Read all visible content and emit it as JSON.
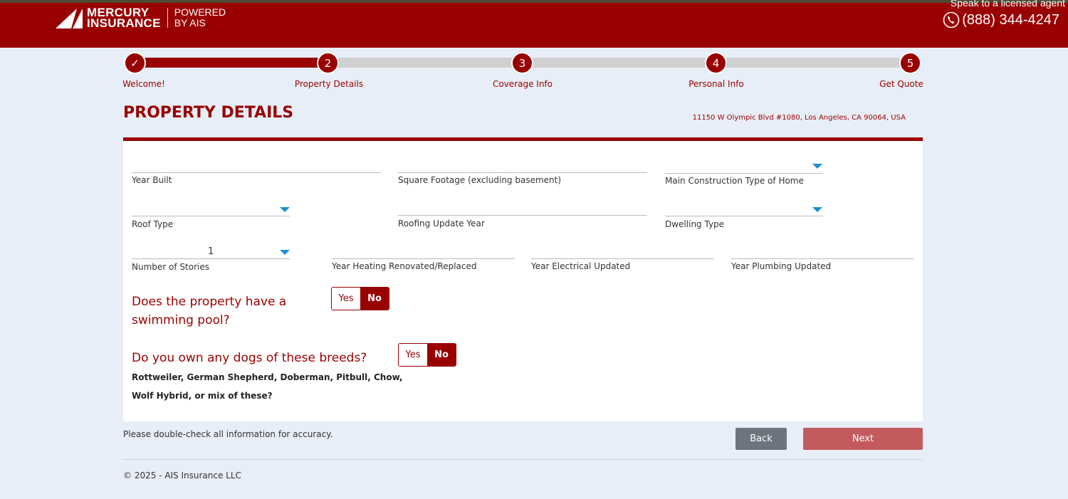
{
  "header": {
    "brand_line1": "MERCURY",
    "brand_line2": "INSURANCE",
    "powered_line1": "POWERED",
    "powered_line2": "BY AIS",
    "speak": "Speak to a licensed agent",
    "phone": "(888) 344-4247"
  },
  "steps": [
    {
      "label": "Welcome!",
      "num": "✓"
    },
    {
      "label": "Property Details",
      "num": "2"
    },
    {
      "label": "Coverage Info",
      "num": "3"
    },
    {
      "label": "Personal Info",
      "num": "4"
    },
    {
      "label": "Get Quote",
      "num": "5"
    }
  ],
  "progress_percent": 25,
  "page": {
    "title": "PROPERTY DETAILS",
    "address": "11150 W Olympic Blvd #1080, Los Angeles, CA 90064, USA"
  },
  "fields": {
    "year_built": "Year Built",
    "sqft": "Square Footage (excluding basement)",
    "construction": "Main Construction Type of Home",
    "roof": "Roof Type",
    "roof_year": "Roofing Update Year",
    "dwelling": "Dwelling Type",
    "stories": "Number of Stories",
    "stories_value": "1",
    "heating": "Year Heating Renovated/Replaced",
    "electrical": "Year Electrical Updated",
    "plumbing": "Year Plumbing Updated"
  },
  "pool": {
    "q1": "Does the property have a",
    "q2": "swimming pool?",
    "yes": "Yes",
    "no": "No",
    "selected": "No"
  },
  "dogs": {
    "q": "Do you own any dogs of these breeds?",
    "sub1": "Rottweiler, German Shepherd, Doberman, Pitbull, Chow,",
    "sub2": "Wolf Hybrid, or mix of these?",
    "yes": "Yes",
    "no": "No",
    "selected": "No"
  },
  "footer": {
    "note": "Please double-check all information for accuracy.",
    "back": "Back",
    "next": "Next",
    "copyright": "© 2025 - AIS Insurance LLC"
  }
}
